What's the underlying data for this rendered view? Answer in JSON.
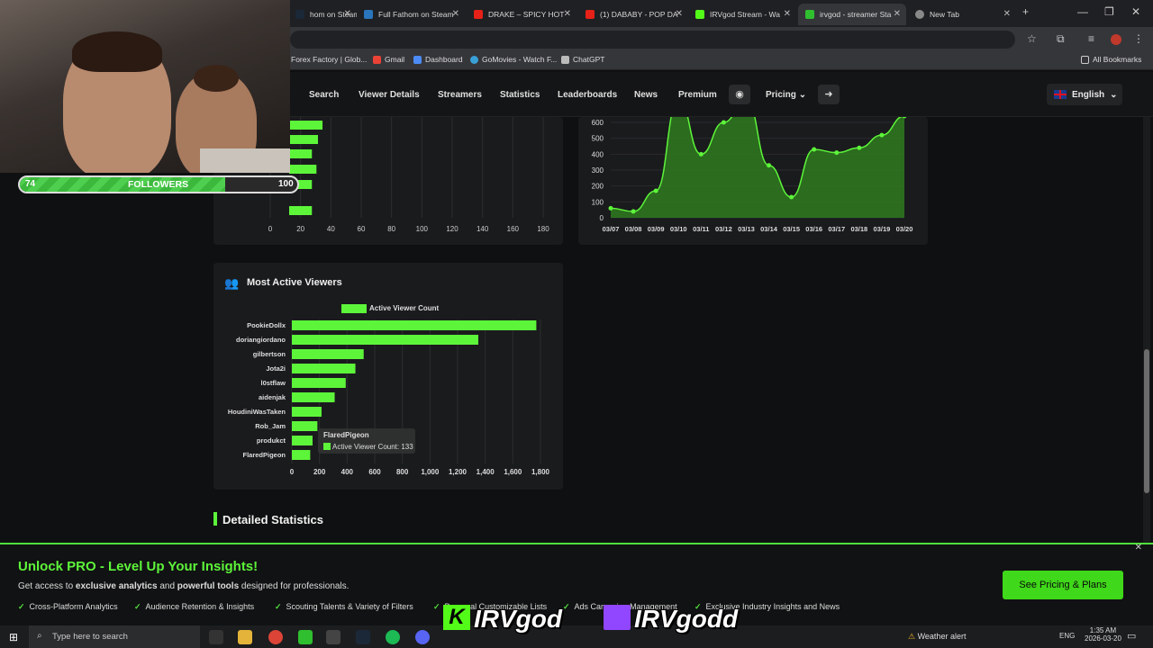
{
  "browser": {
    "tabs": [
      {
        "label": "hom on Steam",
        "active": false
      },
      {
        "label": "Full Fathom on Steam",
        "active": false
      },
      {
        "label": "DRAKE – SPICY HOT",
        "active": false
      },
      {
        "label": "(1) DABABY - POP DA",
        "active": false
      },
      {
        "label": "IRVgod Stream - Wa",
        "active": false
      },
      {
        "label": "irvgod - streamer Sta",
        "active": true
      },
      {
        "label": "New Tab",
        "active": false
      }
    ],
    "bookmarks": [
      "Forex Factory | Glob...",
      "Gmail",
      "Dashboard",
      "GoMovies - Watch F...",
      "ChatGPT"
    ],
    "all_bookmarks": "All Bookmarks"
  },
  "nav": {
    "items": [
      "Search",
      "Viewer Details",
      "Streamers",
      "Statistics",
      "Leaderboards",
      "News",
      "Premium"
    ],
    "pricing": "Pricing",
    "language": "English"
  },
  "overlay": {
    "followers_current": "74",
    "followers_label": "FOLLOWERS",
    "followers_goal": "100",
    "progress": 0.74,
    "kick_name": "IRVgod",
    "twitch_name": "IRVgodd"
  },
  "top_bar_chart": {
    "x_ticks": [
      "0",
      "20",
      "40",
      "60",
      "80",
      "100",
      "120",
      "140",
      "160",
      "180"
    ],
    "visible_values": [
      22,
      19,
      15,
      18,
      15,
      15
    ]
  },
  "chart_data": [
    {
      "type": "area",
      "x": [
        "03/07",
        "03/08",
        "03/09",
        "03/10",
        "03/11",
        "03/12",
        "03/13",
        "03/14",
        "03/15",
        "03/16",
        "03/17",
        "03/18",
        "03/19",
        "03/20"
      ],
      "values": [
        60,
        40,
        170,
        800,
        400,
        600,
        800,
        330,
        130,
        430,
        410,
        440,
        520,
        640
      ],
      "y_ticks": [
        "0",
        "100",
        "200",
        "300",
        "400",
        "500",
        "600"
      ],
      "ylim": [
        0,
        600
      ]
    },
    {
      "type": "bar",
      "title": "Most Active Viewers",
      "legend": "Active Viewer Count",
      "categories": [
        "PookieDollx",
        "doriangiordano",
        "gilbertson",
        "Jota2i",
        "l0stflaw",
        "aidenjak",
        "HoudiniWasTaken",
        "Rob_Jam",
        "produkct",
        "FlaredPigeon"
      ],
      "values": [
        1770,
        1350,
        520,
        460,
        390,
        310,
        215,
        185,
        150,
        133
      ],
      "x_ticks": [
        "0",
        "200",
        "400",
        "600",
        "800",
        "1,000",
        "1,200",
        "1,400",
        "1,600",
        "1,800"
      ],
      "xlim": [
        0,
        1800
      ],
      "tooltip": {
        "title": "FlaredPigeon",
        "label": "Active Viewer Count: 133"
      }
    }
  ],
  "section": {
    "detailed_statistics": "Detailed Statistics"
  },
  "promo": {
    "title": "Unlock PRO - Level Up Your Insights!",
    "subtitle_prefix": "Get access to ",
    "subtitle_b1": "exclusive analytics",
    "subtitle_mid": " and ",
    "subtitle_b2": "powerful tools",
    "subtitle_suffix": " designed for professionals.",
    "features": [
      "Cross-Platform Analytics",
      "Audience Retention & Insights",
      "Scouting Talents & Variety of Filters",
      "Personal Customizable Lists",
      "Ads Campaign Management",
      "Exclusive Industry Insights and News"
    ],
    "cta": "See Pricing & Plans"
  },
  "taskbar": {
    "search_placeholder": "Type here to search",
    "weather": "Weather alert",
    "lang": "ENG",
    "time": "1:35 AM",
    "date": "2026-03-20"
  },
  "colors": {
    "accent": "#5df53a",
    "accent_dark": "#2f7a1e"
  }
}
